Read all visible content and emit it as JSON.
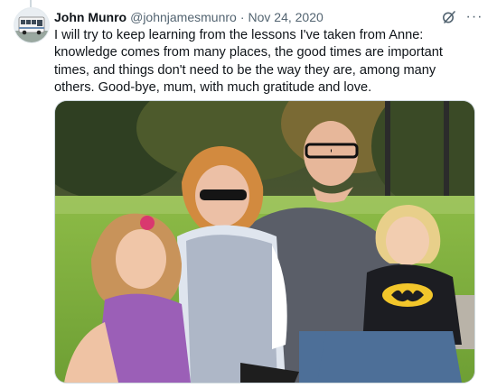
{
  "tweet": {
    "author_name": "John Munro",
    "handle": "@johnjamesmunro",
    "separator": "·",
    "date": "Nov 24, 2020",
    "text": "I will try to keep learning from the lessons I've taken from Anne: knowledge comes from many places, the good times are important times, and things don't need to be the way they are, among many others. Good-bye, mum, with much gratitude and love.",
    "more_glyph": "···",
    "icons": {
      "avatar": "bus-avatar",
      "grok": "grok-icon",
      "more": "more-icon"
    }
  },
  "colors": {
    "text": "#0f1419",
    "secondary": "#536471",
    "border": "#cfd9de"
  }
}
